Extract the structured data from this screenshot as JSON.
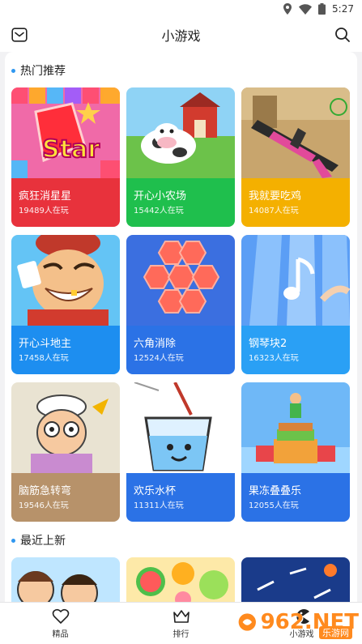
{
  "status": {
    "time": "5:27"
  },
  "appbar": {
    "title": "小游戏",
    "left_icon": "mail-icon",
    "right_icon": "search-icon"
  },
  "hot": {
    "title": "热门推荐",
    "games": [
      {
        "name": "疯狂消星星",
        "players": "19489人在玩",
        "color": "#e8323c",
        "art": "star-puzzle"
      },
      {
        "name": "开心小农场",
        "players": "15442人在玩",
        "color": "#1fbf4d",
        "art": "farm"
      },
      {
        "name": "我就要吃鸡",
        "players": "14087人在玩",
        "color": "#f4b000",
        "art": "rifle"
      },
      {
        "name": "开心斗地主",
        "players": "17458人在玩",
        "color": "#1d8ef0",
        "art": "landlord"
      },
      {
        "name": "六角消除",
        "players": "12524人在玩",
        "color": "#2b72e6",
        "art": "hexagon"
      },
      {
        "name": "钢琴块2",
        "players": "16323人在玩",
        "color": "#2aa0f5",
        "art": "piano"
      },
      {
        "name": "脑筋急转弯",
        "players": "19546人在玩",
        "color": "#b7926a",
        "art": "brain"
      },
      {
        "name": "欢乐水杯",
        "players": "11311人在玩",
        "color": "#2b72e6",
        "art": "cup"
      },
      {
        "name": "果冻叠叠乐",
        "players": "12055人在玩",
        "color": "#2b72e6",
        "art": "jelly"
      }
    ]
  },
  "recent": {
    "title": "最近上新"
  },
  "tabs": [
    {
      "label": "精品",
      "icon": "heart-outline-icon"
    },
    {
      "label": "排行",
      "icon": "crown-icon"
    },
    {
      "label": "小游戏",
      "icon": "pacman-icon"
    }
  ],
  "watermark": {
    "text": "962.NET",
    "sub": "乐游网"
  }
}
